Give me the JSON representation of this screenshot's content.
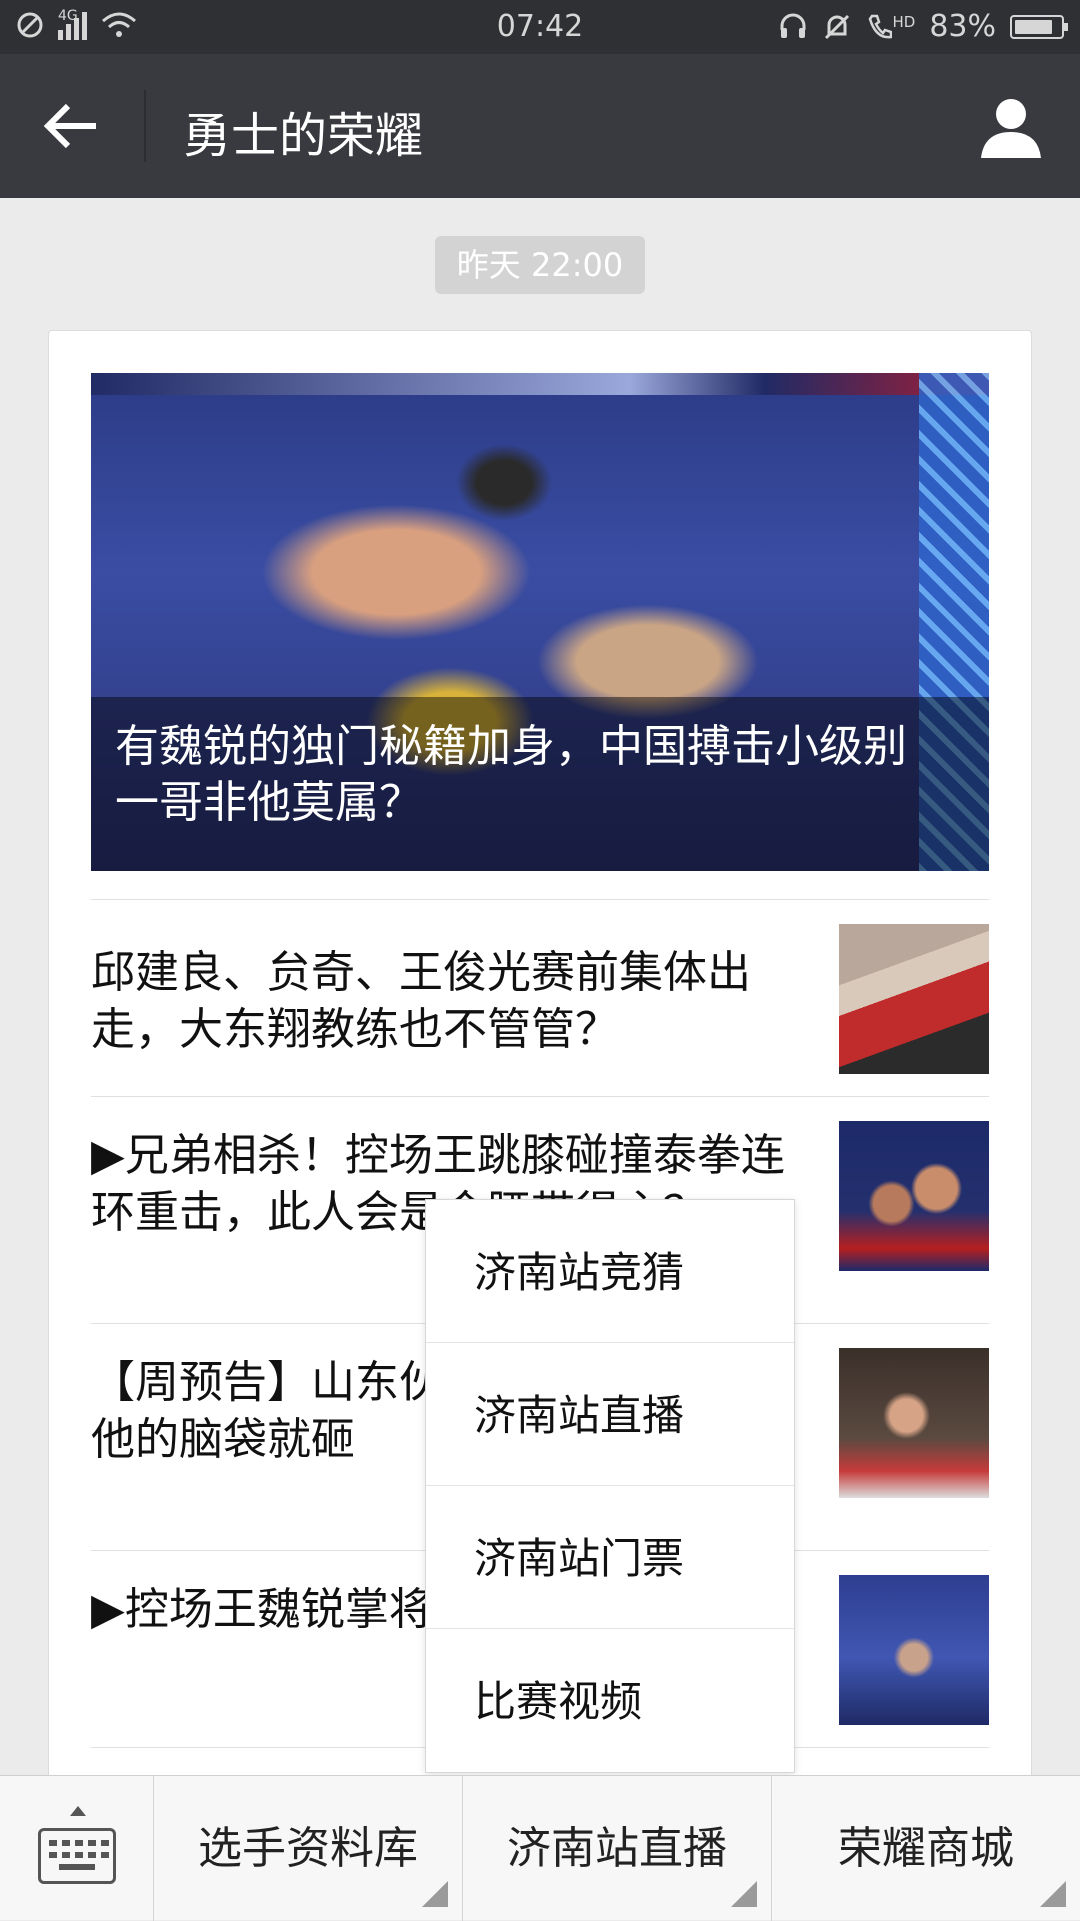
{
  "status_bar": {
    "network_label": "4G",
    "time": "07:42",
    "hd_label": "HD",
    "battery_percent": "83%",
    "battery_level": 0.83,
    "icons": [
      "no-disturb-icon",
      "signal-icon",
      "wifi-icon",
      "headset-icon",
      "alarm-icon",
      "volte-icon",
      "battery-icon"
    ]
  },
  "nav": {
    "title": "勇士的荣耀",
    "icons": [
      "back-arrow-icon",
      "profile-icon"
    ]
  },
  "timestamp": "昨天 22:00",
  "articles": {
    "cover": {
      "title": "有魏锐的独门秘籍加身，中国搏击小级别一哥非他莫属？"
    },
    "items": [
      {
        "title": "邱建良、贠奇、王俊光赛前集体出走，大东翔教练也不管管？"
      },
      {
        "title": "▶兄弟相杀！控场王跳膝碰撞泰拳连环重击，此人会是金腰带得主？"
      },
      {
        "title": "【周预告】山东伙遭老外言辞挑着他的脑袋就砸"
      },
      {
        "title": "▶控场王魏锐掌将意大利搏击一"
      }
    ]
  },
  "popup_menu": {
    "items": [
      {
        "label": "济南站竞猜"
      },
      {
        "label": "济南站直播"
      },
      {
        "label": "济南站门票"
      },
      {
        "label": "比赛视频"
      }
    ]
  },
  "bottom_menu": {
    "icons": [
      "keyboard-icon"
    ],
    "tabs": [
      {
        "label": "选手资料库"
      },
      {
        "label": "济南站直播"
      },
      {
        "label": "荣耀商城"
      }
    ]
  },
  "colors": {
    "nav_bg": "#393a3f",
    "status_bg": "#2e3033",
    "page_bg": "#ebebeb"
  }
}
